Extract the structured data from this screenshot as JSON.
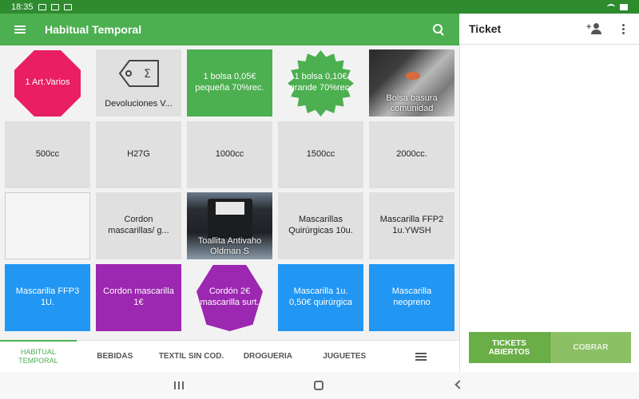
{
  "status": {
    "time": "18:35"
  },
  "app": {
    "title": "Habitual Temporal"
  },
  "ticket": {
    "title": "Ticket",
    "btn_tickets_line1": "TICKETS",
    "btn_tickets_line2": "ABIERTOS",
    "btn_cobrar": "COBRAR"
  },
  "tiles": [
    {
      "label": "1 Art.Varios",
      "color": "#e91e63",
      "shape": "octagon"
    },
    {
      "label": "Devoluciones V...",
      "kind": "tag"
    },
    {
      "label": "1 bolsa 0,05€ pequeña 70%rec.",
      "color": "#4caf50"
    },
    {
      "label": "1 bolsa 0,10€ grande 70%rec.",
      "color": "#4caf50",
      "shape": "star"
    },
    {
      "label": "Bolsa basura comunidad",
      "kind": "photo"
    },
    {
      "label": "500cc"
    },
    {
      "label": "H27G"
    },
    {
      "label": "1000cc"
    },
    {
      "label": "1500cc"
    },
    {
      "label": "2000cc."
    },
    {
      "label": ""
    },
    {
      "label": "Cordon mascarillas/ g..."
    },
    {
      "label": "Toallita Antivaho Oldman S",
      "kind": "photo"
    },
    {
      "label": "Mascarillas Quirúrgicas 10u."
    },
    {
      "label": "Mascarilla FFP2 1u.YWSH"
    },
    {
      "label": "Mascarilla FFP3 1U.",
      "color": "#2196f3"
    },
    {
      "label": "Cordon mascarilla 1€",
      "color": "#9c27b0"
    },
    {
      "label": "Cordón 2€ mascarilla surt.",
      "color": "#9c27b0",
      "shape": "hexagon"
    },
    {
      "label": "Mascarilla 1u. 0,50€ quirúrgica",
      "color": "#2196f3"
    },
    {
      "label": "Mascarilla neopreno",
      "color": "#2196f3"
    }
  ],
  "tabs": [
    {
      "label_line1": "HABITUAL",
      "label_line2": "TEMPORAL",
      "active": true
    },
    {
      "label": "BEBIDAS"
    },
    {
      "label": "TEXTIL SIN COD."
    },
    {
      "label": "DROGUERIA"
    },
    {
      "label": "JUGUETES"
    }
  ],
  "icons": {
    "menu": "menu-icon",
    "search": "search-icon",
    "add_customer": "person-add-icon",
    "more": "more-vert-icon",
    "list": "list-icon",
    "tag": "price-tag-icon"
  }
}
